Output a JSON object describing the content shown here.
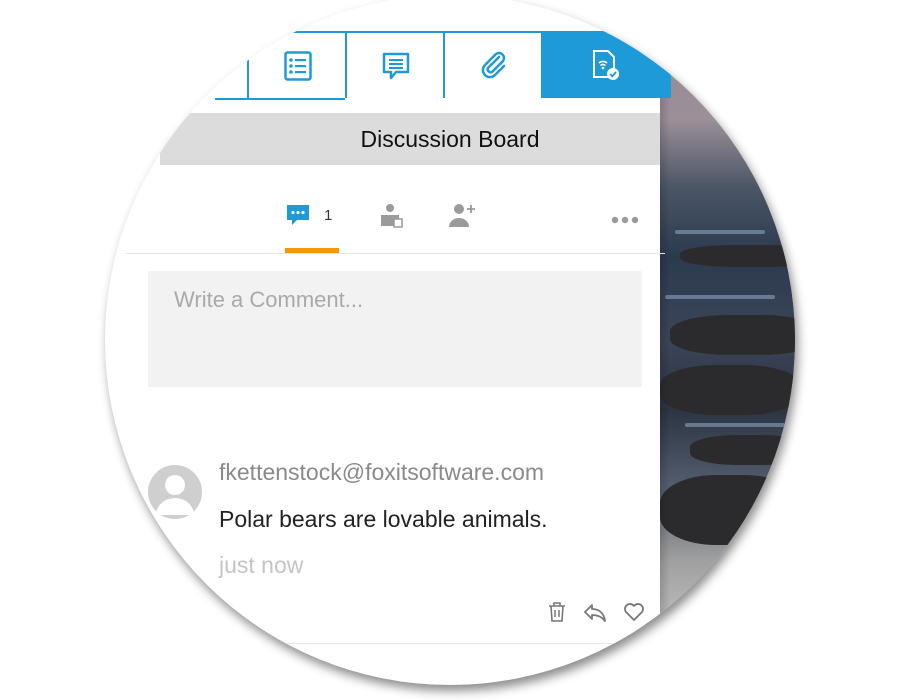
{
  "toolbar": {
    "tabs": [
      {
        "name": "list",
        "icon": "list-icon"
      },
      {
        "name": "comments",
        "icon": "comment-icon"
      },
      {
        "name": "attachments",
        "icon": "paperclip-icon"
      },
      {
        "name": "connected",
        "icon": "connected-doc-icon"
      }
    ],
    "active_color": "#1e9ad8"
  },
  "header": {
    "title": "Discussion Board"
  },
  "sub_tabs": {
    "comments_count": "1",
    "comments_icon": "comment-bubble-icon",
    "assign_icon": "assign-icon",
    "invite_icon": "add-user-icon",
    "more_icon": "more-icon",
    "active_underline_color": "#f29800"
  },
  "comment_input": {
    "placeholder": "Write a Comment..."
  },
  "comments": [
    {
      "author": "fkettenstock@foxitsoftware.com",
      "text": "Polar bears are lovable animals.",
      "time": "just now"
    }
  ],
  "comment_actions": [
    "trash-icon",
    "reply-icon",
    "heart-icon"
  ]
}
